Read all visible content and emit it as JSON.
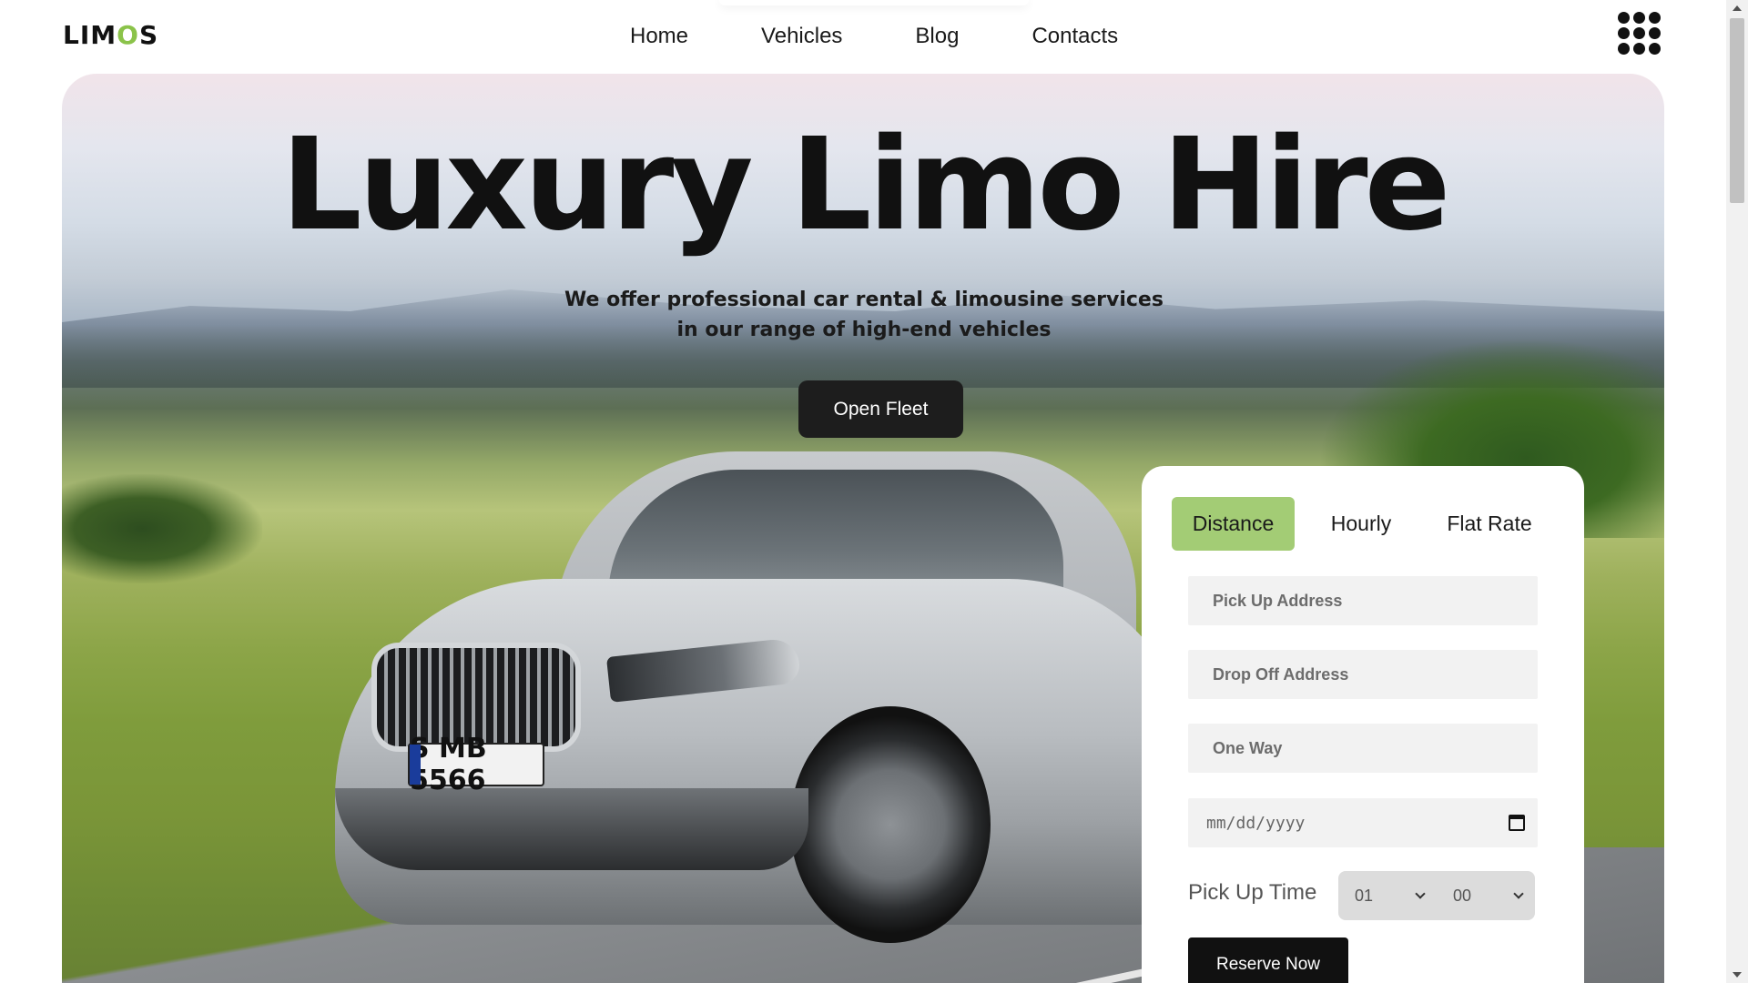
{
  "header": {
    "logo": {
      "text_before": "LIM",
      "text_accent": "O",
      "text_after": "S"
    },
    "nav": [
      {
        "label": "Home"
      },
      {
        "label": "Vehicles"
      },
      {
        "label": "Blog"
      },
      {
        "label": "Contacts"
      }
    ],
    "menu_icon": "grid-dots-icon"
  },
  "hero": {
    "title": "Luxury Limo Hire",
    "subtitle_line1": "We offer professional car rental & limousine services",
    "subtitle_line2": "in our range of high-end vehicles",
    "cta_label": "Open Fleet",
    "car_plate": "S MB 5566"
  },
  "booking": {
    "tabs": [
      {
        "label": "Distance",
        "active": true
      },
      {
        "label": "Hourly",
        "active": false
      },
      {
        "label": "Flat Rate",
        "active": false
      }
    ],
    "pickup_placeholder": "Pick Up Address",
    "dropoff_placeholder": "Drop Off Address",
    "trip_placeholder": "One Way",
    "date_placeholder": "mm/dd/yyyy",
    "time_label": "Pick Up Time",
    "hour_value": "01",
    "minute_value": "00",
    "submit_label": "Reserve Now"
  },
  "colors": {
    "accent": "#a3cc75",
    "dark": "#111111",
    "field_bg": "#f2f2f2"
  }
}
